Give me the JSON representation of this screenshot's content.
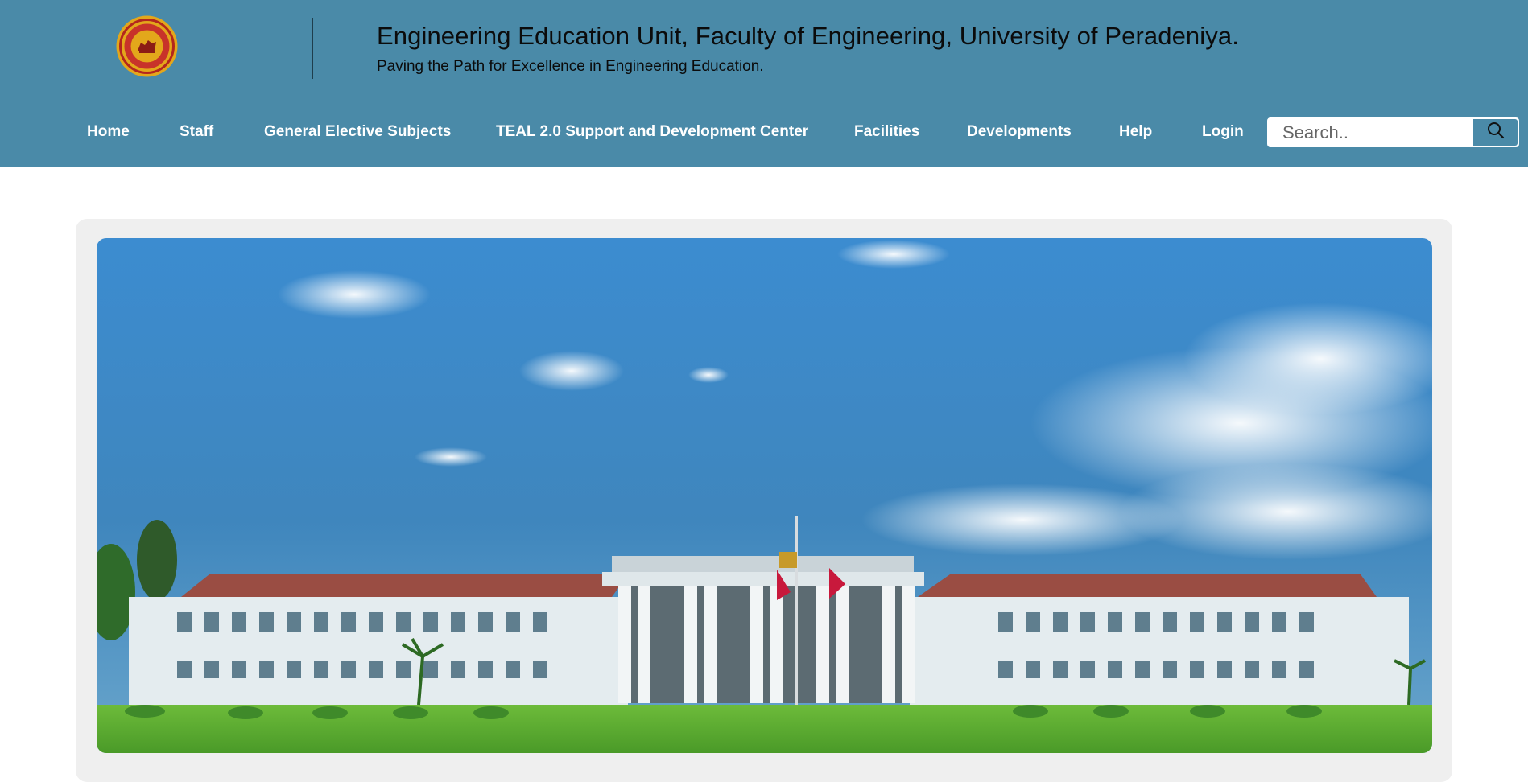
{
  "header": {
    "title": "Engineering Education Unit, Faculty of Engineering, University of Peradeniya.",
    "tagline": "Paving the Path for Excellence in Engineering Education.",
    "logo_icon": "university-crest-icon",
    "background_color": "#4a8aa8"
  },
  "nav": {
    "items": [
      {
        "label": "Home"
      },
      {
        "label": "Staff"
      },
      {
        "label": "General Elective Subjects"
      },
      {
        "label": "TEAL 2.0 Support and Development Center"
      },
      {
        "label": "Facilities"
      },
      {
        "label": "Developments"
      },
      {
        "label": "Help"
      },
      {
        "label": "Login"
      }
    ]
  },
  "search": {
    "placeholder": "Search..",
    "value": "",
    "button_icon": "search-icon"
  },
  "hero": {
    "image_icon": "faculty-building-photo",
    "sky_color": "#3e8dcb",
    "lawn_color": "#5aa52e"
  }
}
